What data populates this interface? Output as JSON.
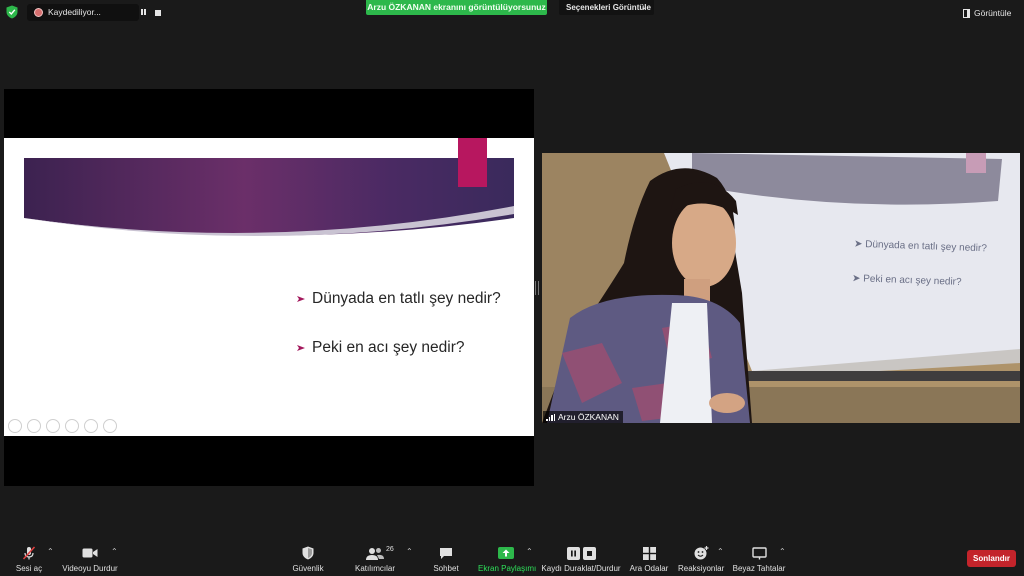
{
  "top_bar": {
    "recording_label": "Kaydediliyor...",
    "share_banner": "Arzu ÖZKANAN ekranını görüntülüyorsunuz",
    "view_options": "Seçenekleri Görüntüle",
    "view_button": "Görüntüle"
  },
  "slide": {
    "bullets": [
      "Dünyada en tatlı şey nedir?",
      "Peki en acı şey nedir?"
    ]
  },
  "video": {
    "participant_name": "Arzu ÖZKANAN",
    "projected_bullets": [
      "Dünyada en tatlı şey nedir?",
      "Peki en acı şey nedir?"
    ]
  },
  "toolbar": {
    "mute": "Sesi aç",
    "video": "Videoyu Durdur",
    "security": "Güvenlik",
    "participants": "Katılımcılar",
    "participants_count": "26",
    "chat": "Sohbet",
    "share_screen": "Ekran Paylaşımı",
    "pause_recording": "Kaydı Duraklat/Durdur",
    "breakout_rooms": "Ara Odalar",
    "reactions": "Reaksiyonlar",
    "whiteboard": "Beyaz Tahtalar",
    "end": "Sonlandır"
  },
  "colors": {
    "share_green": "#2db84b",
    "end_red": "#c3242b",
    "slide_accent": "#b7175f"
  }
}
